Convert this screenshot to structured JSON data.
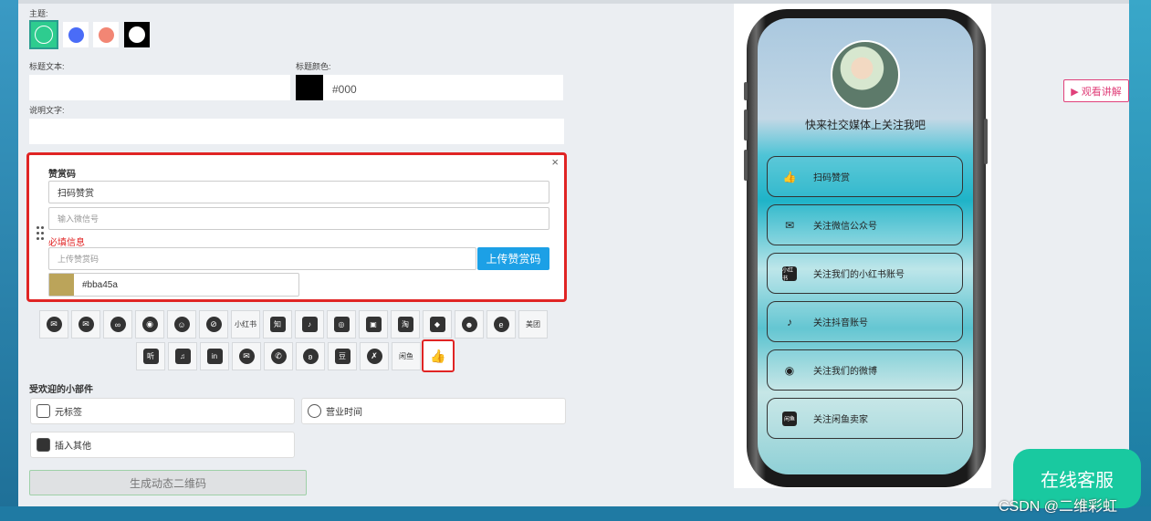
{
  "editor": {
    "theme_label": "主题:",
    "theme_colors": [
      "#2ecc8f",
      "#4a6cf7",
      "#f28674",
      "#000000"
    ],
    "title_text_label": "标题文本:",
    "title_text_value": "",
    "title_color_label": "标题颜色:",
    "title_color_value": "#000",
    "desc_label": "说明文字:",
    "desc_value": ""
  },
  "reward_card": {
    "heading": "赞赏码",
    "title_value": "扫码赞赏",
    "wechat_placeholder": "输入微信号",
    "required_text": "必填信息",
    "upload_placeholder": "上传赞赏码",
    "upload_button": "上传赞赏码",
    "color_value": "#bba45a",
    "close_symbol": "×"
  },
  "icon_row1": [
    {
      "name": "wechat-icon",
      "glyph": "✉"
    },
    {
      "name": "wechat-official-icon",
      "glyph": "✉"
    },
    {
      "name": "link-circle-icon",
      "glyph": "∞"
    },
    {
      "name": "weibo-icon",
      "glyph": "◉"
    },
    {
      "name": "qq-icon",
      "glyph": "☺"
    },
    {
      "name": "link-icon",
      "glyph": "⊘"
    },
    {
      "name": "xiaohongshu-icon",
      "glyph": "小红书"
    },
    {
      "name": "zhihu-icon",
      "glyph": "知"
    },
    {
      "name": "douyin-icon",
      "glyph": "♪"
    },
    {
      "name": "kuaishou-icon",
      "glyph": "◎"
    },
    {
      "name": "bilibili-icon",
      "glyph": "▣"
    },
    {
      "name": "taobao-icon",
      "glyph": "淘"
    },
    {
      "name": "pinduoduo-icon",
      "glyph": "◆"
    },
    {
      "name": "miniapp-icon",
      "glyph": "☻"
    },
    {
      "name": "ele-icon",
      "glyph": "e"
    },
    {
      "name": "meituan-icon",
      "glyph": "美团"
    }
  ],
  "icon_row2": [
    {
      "name": "ting-icon",
      "glyph": "听"
    },
    {
      "name": "spotify-icon",
      "glyph": "♫"
    },
    {
      "name": "linkedin-icon",
      "glyph": "in"
    },
    {
      "name": "email-icon",
      "glyph": "✉"
    },
    {
      "name": "phone-icon",
      "glyph": "✆"
    },
    {
      "name": "butterfly-icon",
      "glyph": "ʚ"
    },
    {
      "name": "douban-icon",
      "glyph": "豆"
    },
    {
      "name": "keep-icon",
      "glyph": "✗"
    },
    {
      "name": "xianyu-icon",
      "glyph": "闲鱼"
    },
    {
      "name": "thumbs-up-icon",
      "glyph": "👍"
    }
  ],
  "widgets": {
    "section_title": "受欢迎的小部件",
    "items": [
      "元标签",
      "营业时间",
      "插入其他"
    ],
    "generate_button": "生成动态二维码"
  },
  "preview": {
    "headline": "快来社交媒体上关注我吧",
    "buttons": [
      {
        "icon": "thumbs-up-icon",
        "label": "扫码赞赏",
        "glyph": "👍"
      },
      {
        "icon": "wechat-icon",
        "label": "关注微信公众号",
        "glyph": "✉"
      },
      {
        "icon": "xiaohongshu-icon",
        "label": "关注我们的小红书账号",
        "glyph": "小红书"
      },
      {
        "icon": "douyin-icon",
        "label": "关注抖音账号",
        "glyph": "♪"
      },
      {
        "icon": "weibo-icon",
        "label": "关注我们的微博",
        "glyph": "◉"
      },
      {
        "icon": "xianyu-icon",
        "label": "关注闲鱼卖家",
        "glyph": "闲鱼"
      }
    ]
  },
  "side": {
    "watch_button": "▶ 观看讲解",
    "service_button": "在线客服",
    "watermark": "CSDN @二维彩虹"
  }
}
